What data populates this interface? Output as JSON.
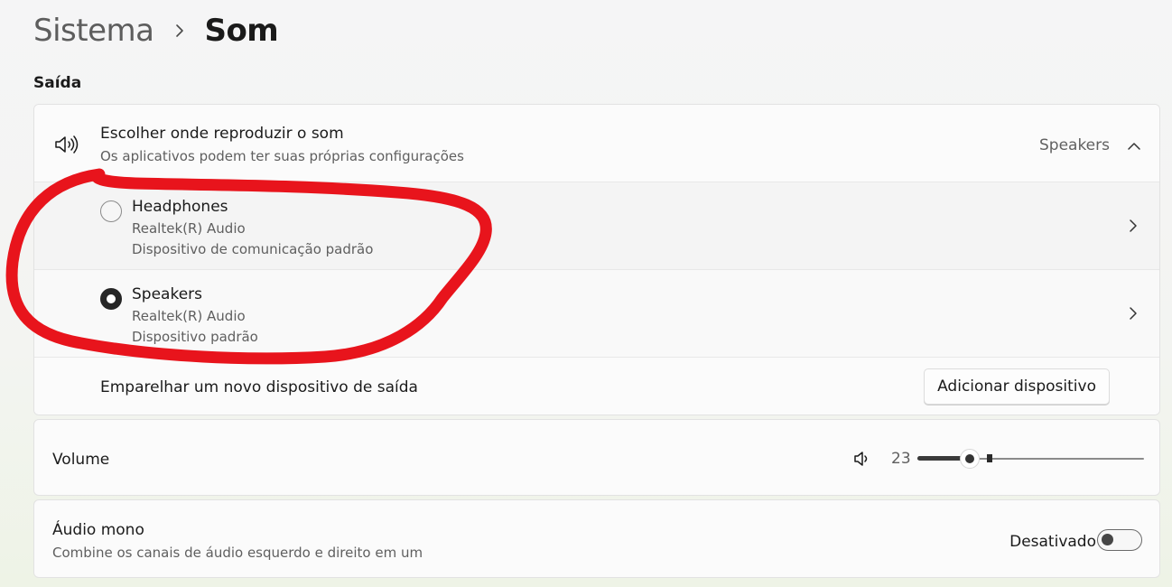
{
  "breadcrumb": {
    "parent": "Sistema",
    "separator_icon": "chevron-right-icon",
    "current": "Som"
  },
  "output": {
    "section_title": "Saída",
    "header": {
      "icon": "speaker-icon",
      "title": "Escolher onde reproduzir o som",
      "subtitle": "Os aplicativos podem ter suas próprias configurações",
      "selected_value": "Speakers",
      "expand_icon": "chevron-up-icon"
    },
    "devices": [
      {
        "name": "Headphones",
        "driver": "Realtek(R) Audio",
        "role": "Dispositivo de comunicação padrão",
        "selected": false
      },
      {
        "name": "Speakers",
        "driver": "Realtek(R) Audio",
        "role": "Dispositivo padrão",
        "selected": true
      }
    ],
    "pair": {
      "label": "Emparelhar um novo dispositivo de saída",
      "button_label": "Adicionar dispositivo"
    }
  },
  "volume": {
    "label": "Volume",
    "icon": "speaker-low-icon",
    "value": "23",
    "level_percent": 23
  },
  "mono_audio": {
    "title": "Áudio mono",
    "subtitle": "Combine os canais de áudio esquerdo e direito em um",
    "state_label": "Desativado",
    "enabled": false
  },
  "annotation": {
    "shape": "hand-drawn ellipse",
    "color": "#e8141c"
  }
}
